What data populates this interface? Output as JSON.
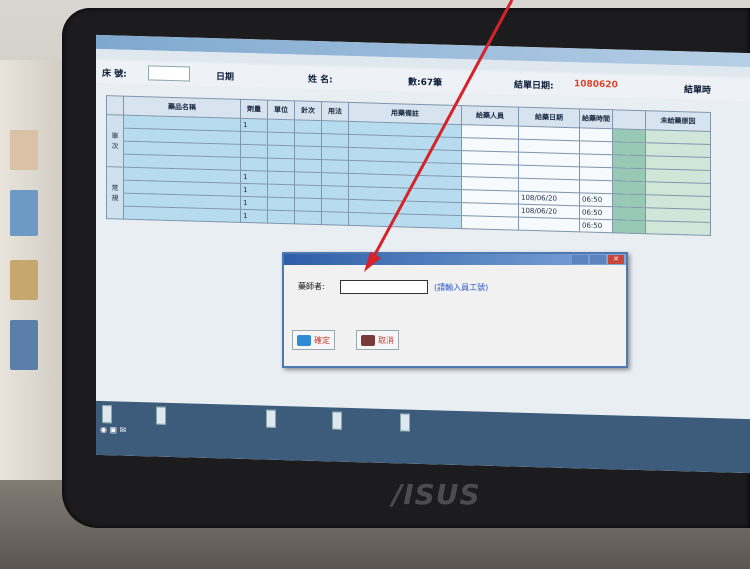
{
  "scene": {
    "brand": "/ISUS",
    "wall_color": "#d9d6d1",
    "arrow_color": "#d6222a"
  },
  "app": {
    "menu": [
      "",
      "",
      "",
      "",
      "",
      ""
    ],
    "info": {
      "date_label": "日期",
      "record_count": "數:67筆",
      "date_prefix": "結單日期:",
      "date_value": "1080620",
      "right_label": "結單時"
    },
    "table": {
      "headers": [
        "藥品名稱",
        "劑量",
        "單位",
        "針次",
        "用法",
        "用藥備註",
        "給藥人員",
        "給藥日期",
        "給藥時間",
        "未給藥原因"
      ],
      "rows": [
        {
          "values": [
            "",
            "1",
            "",
            "",
            "",
            "",
            "",
            "",
            "",
            ""
          ]
        },
        {
          "values": [
            "",
            "",
            "",
            "",
            "",
            "",
            "",
            "",
            "",
            ""
          ]
        },
        {
          "values": [
            "",
            "",
            "",
            "",
            "",
            "",
            "",
            "",
            "",
            ""
          ]
        },
        {
          "values": [
            "",
            "",
            "",
            "",
            "",
            "",
            "",
            "",
            "",
            ""
          ]
        },
        {
          "values": [
            "",
            "1",
            "",
            "",
            "",
            "",
            "",
            "",
            "",
            ""
          ]
        },
        {
          "values": [
            "",
            "1",
            "",
            "",
            "",
            "",
            "",
            "108/06/20",
            "06:50",
            ""
          ]
        },
        {
          "values": [
            "",
            "1",
            "",
            "",
            "",
            "",
            "",
            "108/06/20",
            "06:50",
            ""
          ]
        },
        {
          "values": [
            "",
            "1",
            "",
            "",
            "",
            "",
            "",
            "",
            "06:50",
            ""
          ]
        }
      ]
    }
  },
  "dialog": {
    "title": "",
    "field_label": "藥師者:",
    "hint": "(請輸入員工號)",
    "note": "",
    "ok_label": "確定",
    "cancel_label": "取消"
  },
  "taskbar": {
    "items": [
      "",
      "",
      "",
      "",
      ""
    ]
  }
}
